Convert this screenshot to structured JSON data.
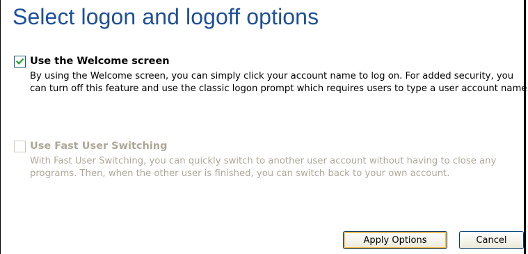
{
  "page": {
    "title": "Select logon and logoff options"
  },
  "options": {
    "welcome": {
      "label": "Use the Welcome screen",
      "checked": true,
      "enabled": true,
      "description": "By using the Welcome screen, you can simply click your account name to log on. For added security, you can turn off this feature and use the classic logon prompt which requires users to type a user account name."
    },
    "fast_user_switching": {
      "label": "Use Fast User Switching",
      "checked": false,
      "enabled": false,
      "description": "With Fast User Switching, you can quickly switch to another user account without having to close any programs. Then, when the other user is finished, you can switch back to your own account."
    }
  },
  "buttons": {
    "apply_label": "Apply Options",
    "cancel_label": "Cancel"
  },
  "colors": {
    "title": "#1f4f9a",
    "disabled_text": "#aca899",
    "checkmark": "#21a121",
    "button_focus_ring": "#f7be57"
  }
}
